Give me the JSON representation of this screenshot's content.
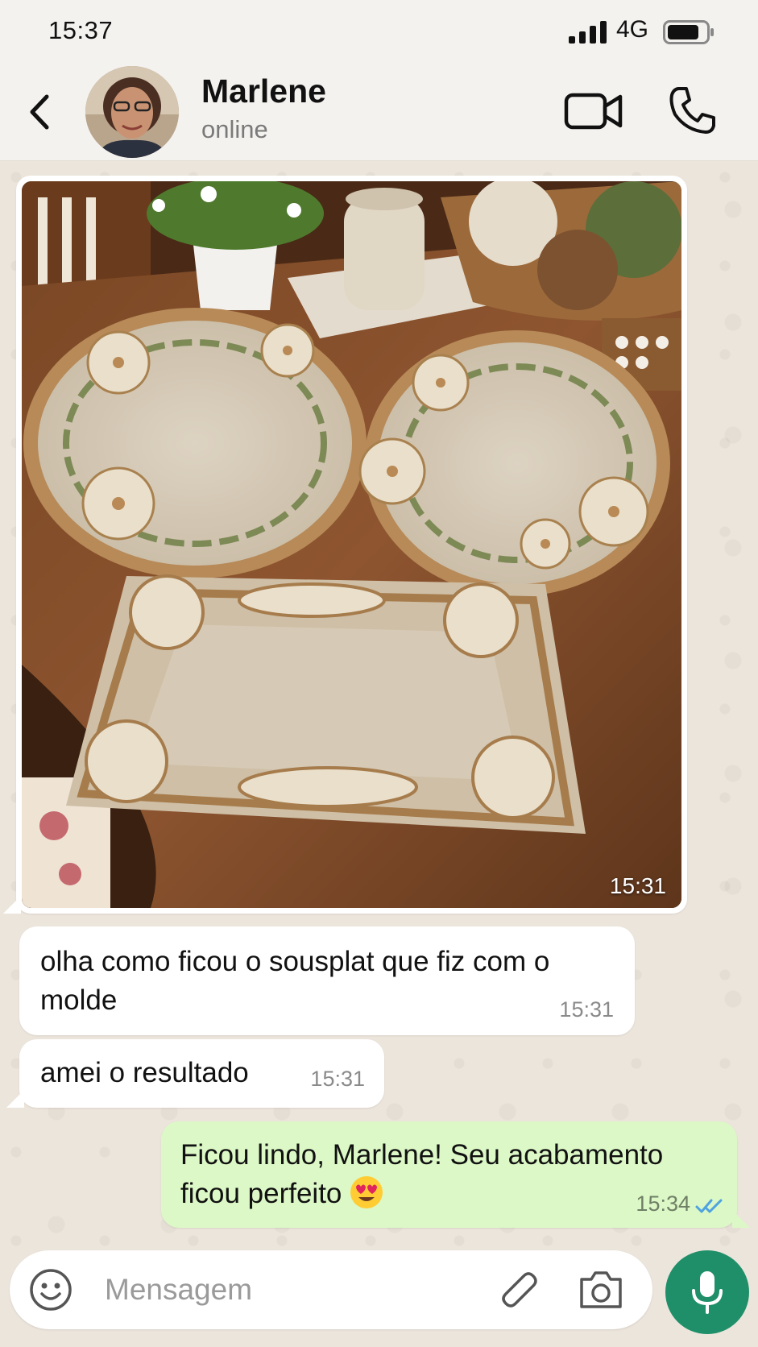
{
  "status_bar": {
    "time": "15:37",
    "network": "4G"
  },
  "header": {
    "contact_name": "Marlene",
    "contact_status": "online",
    "icons": [
      "back-arrow-icon",
      "video-call-icon",
      "phone-icon"
    ]
  },
  "messages": [
    {
      "type": "image",
      "direction": "incoming",
      "time": "15:31",
      "image_description_icon": "photo-placemats"
    },
    {
      "type": "text",
      "direction": "incoming",
      "text": "olha como ficou o sousplat que fiz com o molde",
      "time": "15:31"
    },
    {
      "type": "text",
      "direction": "incoming",
      "text": "amei o resultado",
      "time": "15:31"
    },
    {
      "type": "text",
      "direction": "outgoing",
      "text": "Ficou lindo, Marlene! Seu acabamento ficou perfeito",
      "emoji": "heart-eyes-emoji",
      "time": "15:34",
      "read_status": "read"
    }
  ],
  "input": {
    "placeholder": "Mensagem",
    "value": ""
  },
  "colors": {
    "outgoing_bubble": "#dcf8c6",
    "incoming_bubble": "#ffffff",
    "mic_button": "#1f8f6a",
    "read_ticks": "#4fa3e0",
    "wallpaper": "#ece5dc"
  }
}
